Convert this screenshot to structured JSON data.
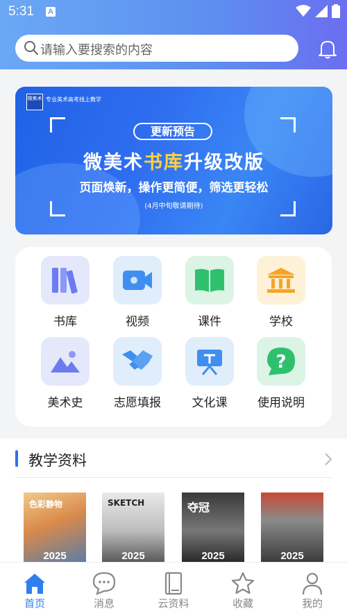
{
  "status_bar": {
    "time": "5:31",
    "app_badge": "A"
  },
  "search": {
    "placeholder": "请输入要搜索的内容"
  },
  "banner": {
    "brand_logo": "微美术",
    "brand_tag": "专业美术高考线上教学",
    "pill": "更新预告",
    "title_a": "微美术",
    "title_highlight": "书库",
    "title_b": "升级改版",
    "subtitle": "页面焕新，操作更简便，筛选更轻松",
    "note": "(4月中旬敬请期待)"
  },
  "grid": [
    {
      "label": "书库",
      "icon": "books-icon"
    },
    {
      "label": "视频",
      "icon": "video-camera-icon"
    },
    {
      "label": "课件",
      "icon": "open-book-icon"
    },
    {
      "label": "学校",
      "icon": "school-building-icon"
    },
    {
      "label": "美术史",
      "icon": "landscape-picture-icon"
    },
    {
      "label": "志愿填报",
      "icon": "handshake-icon"
    },
    {
      "label": "文化课",
      "icon": "easel-board-icon"
    },
    {
      "label": "使用说明",
      "icon": "question-bubble-icon"
    }
  ],
  "section": {
    "title": "教学资料",
    "books": [
      {
        "year": "2025",
        "title": "色彩静物"
      },
      {
        "year": "2025",
        "title": "SKETCH"
      },
      {
        "year": "2025",
        "title": "夺冠"
      },
      {
        "year": "2025",
        "title": ""
      }
    ]
  },
  "tabs": [
    {
      "label": "首页",
      "icon": "home-icon",
      "active": true
    },
    {
      "label": "消息",
      "icon": "chat-bubble-icon",
      "active": false
    },
    {
      "label": "云资料",
      "icon": "document-icon",
      "active": false
    },
    {
      "label": "收藏",
      "icon": "star-icon",
      "active": false
    },
    {
      "label": "我的",
      "icon": "person-icon",
      "active": false
    }
  ],
  "colors": {
    "accent": "#2f7ff0",
    "header_start": "#6aa8f5",
    "header_end": "#6b6ef0",
    "banner_highlight": "#ffd23c"
  }
}
